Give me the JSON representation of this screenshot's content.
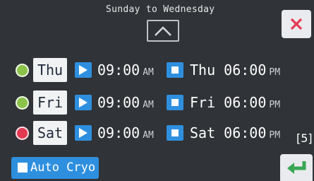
{
  "header": {
    "title": "Sunday to Wednesday"
  },
  "icons": {
    "scroll_up": "chevron-up-icon",
    "close": "close-icon",
    "enter": "enter-return-icon",
    "start": "play-icon",
    "stop": "stop-icon"
  },
  "colors": {
    "accent_blue": "#2f8fdf",
    "status_green": "#8bc34a",
    "status_red": "#e53952",
    "close_red": "#e53952",
    "enter_green": "#3aa655",
    "background": "#303337"
  },
  "schedule": [
    {
      "day": "Thu",
      "status": "green",
      "start_time": "09:00",
      "start_ampm": "AM",
      "end_time": "Thu 06:00",
      "end_ampm": "PM"
    },
    {
      "day": "Fri",
      "status": "green",
      "start_time": "09:00",
      "start_ampm": "AM",
      "end_time": "Fri 06:00",
      "end_ampm": "PM"
    },
    {
      "day": "Sat",
      "status": "red",
      "start_time": "09:00",
      "start_ampm": "AM",
      "end_time": "Sat 06:00",
      "end_ampm": "PM"
    }
  ],
  "page_indicator": "[5]",
  "auto_cryo": {
    "label": "Auto Cryo"
  }
}
